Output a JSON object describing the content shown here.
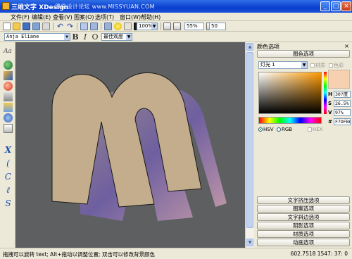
{
  "window": {
    "title": "三维文字 XDesign",
    "watermark": "思缘设计论坛 www.MISSYUAN.COM",
    "controls": [
      "_",
      "□",
      "×"
    ]
  },
  "menu": [
    "文件(F)",
    "编辑(E)",
    "查看(V)",
    "图案(O)",
    "选项(T)",
    "窗口(W)",
    "帮助(H)"
  ],
  "toolbar": {
    "zoom_value": "100%",
    "percent_value": "55%",
    "number_value": "50"
  },
  "formatbar": {
    "font_name": "Anja Eliane",
    "bold_label": "B",
    "italic_label": "I",
    "outline_label": "O",
    "quality_value": "最佳观度"
  },
  "canvas": {
    "text": "M",
    "face_color": "#c4ad8c",
    "background_color": "#5e5f61"
  },
  "color_panel": {
    "title": "颜色选项",
    "close": "×",
    "tab_label": "图色选项",
    "light_select": "灯光 1",
    "check_texture": "材质",
    "check_color": "色彩",
    "h_label": "H",
    "h_value": "30?度",
    "s_label": "S",
    "s_value": "26.5%",
    "v_label": "V",
    "v_value": "97%",
    "hex_label": "#",
    "hex_value": "F7DFB6",
    "radio_hsv": "HSV",
    "radio_rgb": "RGB",
    "check_hex": "HEX",
    "swatch_color": "#f7d0b0"
  },
  "option_sections": [
    "文字挤压选项",
    "图案选项",
    "文字斜边选项",
    "阴影选项",
    "材质选项",
    "动画选项"
  ],
  "status": {
    "left_text": "拖拽可以旋转 text; Alt+拖动以调整位置; 双击可以修改背景颜色",
    "right_text": "602.7518  1547: 37: 0"
  }
}
